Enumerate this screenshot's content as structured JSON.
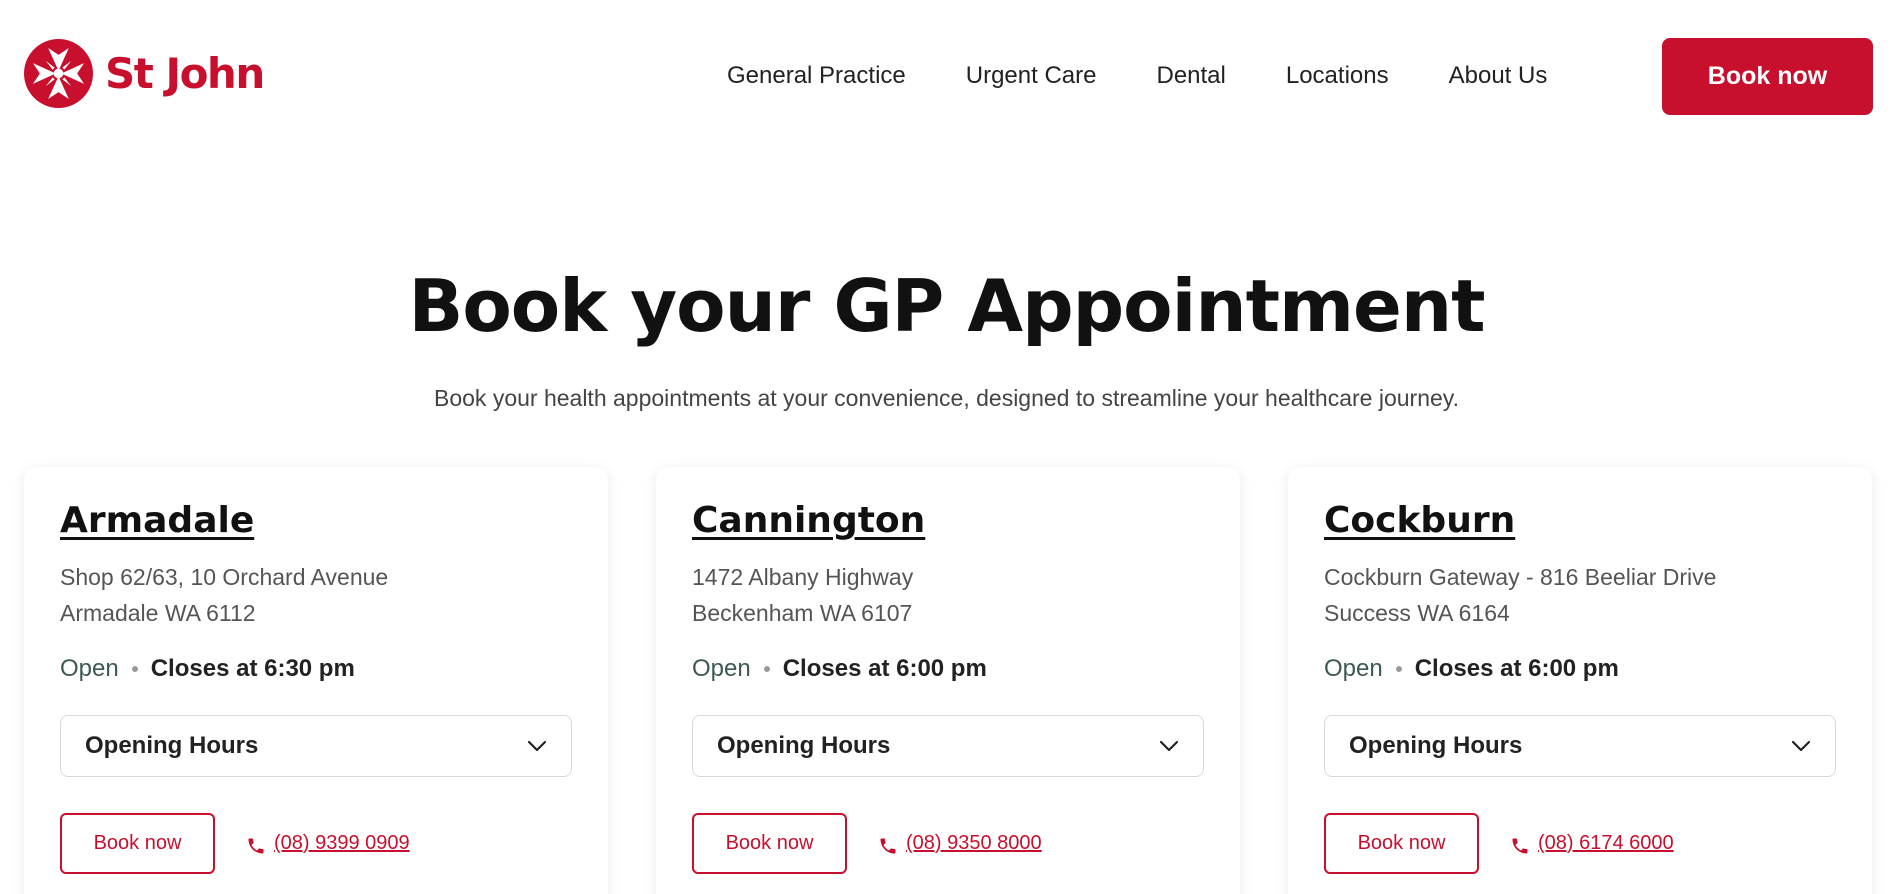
{
  "header": {
    "logo_text": "St John",
    "nav": [
      "General Practice",
      "Urgent Care",
      "Dental",
      "Locations",
      "About Us"
    ],
    "cta_label": "Book now"
  },
  "hero": {
    "title": "Book your GP Appointment",
    "subtitle": "Book your health appointments at your convenience, designed to streamline your healthcare journey."
  },
  "locations": [
    {
      "name": "Armadale",
      "address_line1": "Shop 62/63, 10 Orchard Avenue",
      "address_line2": "Armadale WA 6112",
      "status": "Open",
      "closes": "Closes at 6:30 pm",
      "hours_label": "Opening Hours",
      "book_label": "Book now",
      "phone": "(08) 9399 0909"
    },
    {
      "name": "Cannington",
      "address_line1": "1472 Albany Highway",
      "address_line2": "Beckenham WA 6107",
      "status": "Open",
      "closes": "Closes at 6:00 pm",
      "hours_label": "Opening Hours",
      "book_label": "Book now",
      "phone": "(08) 9350 8000"
    },
    {
      "name": "Cockburn",
      "address_line1": "Cockburn Gateway - 816 Beeliar Drive",
      "address_line2": "Success WA 6164",
      "status": "Open",
      "closes": "Closes at 6:00 pm",
      "hours_label": "Opening Hours",
      "book_label": "Book now",
      "phone": "(08) 6174 6000"
    }
  ],
  "icons": {
    "logo": "st-john-cross-icon",
    "dropdown": "chevron-down-icon",
    "phone": "phone-icon"
  },
  "colors": {
    "brand_red": "#c8102e",
    "status_green": "#3c5a54"
  }
}
